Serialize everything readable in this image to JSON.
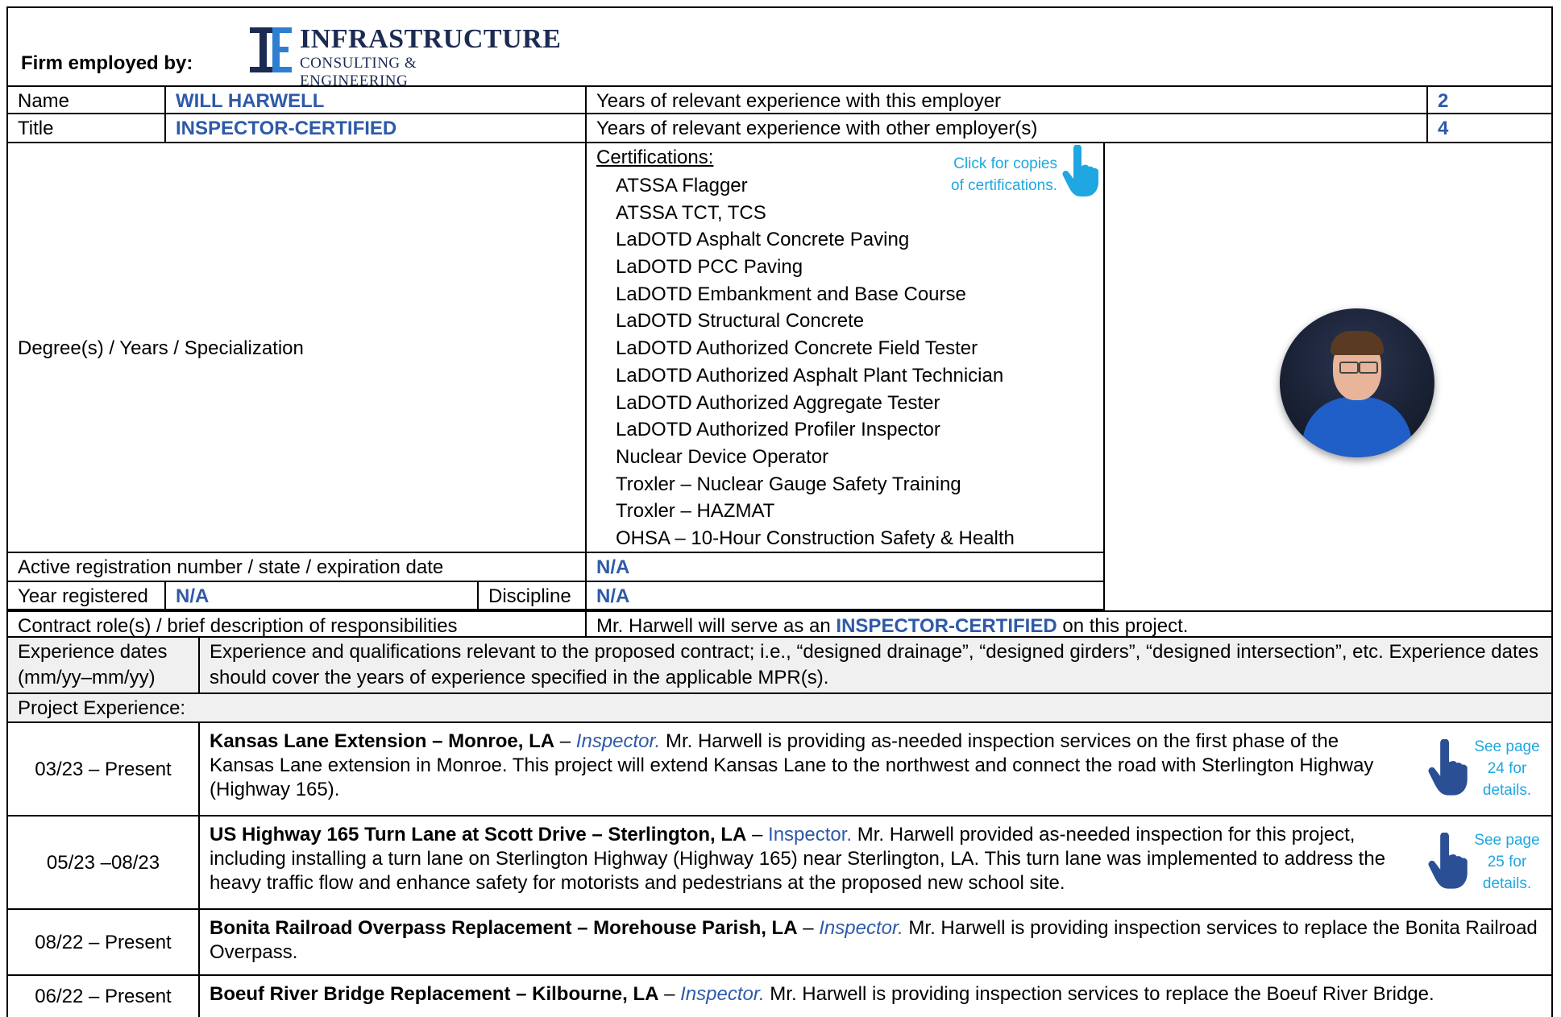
{
  "header": {
    "firm_label": "Firm employed by:",
    "logo_main": "INFRASTRUCTURE",
    "logo_sub": "CONSULTING & ENGINEERING"
  },
  "rows": {
    "name_label": "Name",
    "name_value": "WILL HARWELL",
    "years_this_label": "Years of relevant experience with this employer",
    "years_this_value": "2",
    "title_label": "Title",
    "title_value": "INSPECTOR-CERTIFIED",
    "years_other_label": "Years of relevant experience with other employer(s)",
    "years_other_value": "4",
    "degree_label": "Degree(s) / Years / Specialization",
    "registration_label": "Active registration number / state / expiration date",
    "registration_value": "N/A",
    "year_registered_label": "Year registered",
    "year_registered_value": "N/A",
    "discipline_label": "Discipline",
    "discipline_value": "N/A",
    "contract_role_label": "Contract role(s) / brief description of responsibilities",
    "contract_role_prefix": "Mr. Harwell will serve as an ",
    "contract_role_highlight": "INSPECTOR-CERTIFIED",
    "contract_role_suffix": " on this project.",
    "exp_dates_label": "Experience dates (mm/yy–mm/yy)",
    "exp_desc": "Experience and qualifications relevant to the proposed contract; i.e., “designed drainage”, “designed girders”, “designed intersection”, etc.  Experience dates should cover the years of experience specified in the applicable MPR(s).",
    "project_exp_label": "Project Experience:"
  },
  "certifications": {
    "title": "Certifications:",
    "click_note": "Click for copies of certifications.",
    "items": [
      "ATSSA Flagger",
      "ATSSA TCT, TCS",
      "LaDOTD Asphalt Concrete Paving",
      "LaDOTD PCC Paving",
      "LaDOTD Embankment and Base Course",
      "LaDOTD Structural Concrete",
      "LaDOTD Authorized Concrete Field Tester",
      "LaDOTD Authorized Asphalt Plant Technician",
      "LaDOTD Authorized Aggregate Tester",
      "LaDOTD Authorized Profiler Inspector",
      "Nuclear Device Operator",
      "Troxler – Nuclear Gauge Safety Training",
      "Troxler – HAZMAT",
      "OHSA – 10-Hour Construction Safety & Health"
    ]
  },
  "projects": [
    {
      "dates": "03/23 – Present",
      "title": "Kansas Lane Extension – Monroe, LA",
      "role": "Inspector.",
      "desc": " Mr. Harwell is providing as-needed inspection services on the first phase of the Kansas Lane extension in Monroe. This project will extend Kansas Lane to the northwest and connect the road with Sterlington Highway (Highway 165).",
      "see_page": "See page 24 for details."
    },
    {
      "dates": "05/23 –08/23",
      "title": "US Highway 165 Turn Lane at Scott Drive – Sterlington, LA",
      "role": "Inspector.",
      "desc": " Mr. Harwell provided as-needed inspection for this project, including installing a turn lane on Sterlington Highway (Highway 165) near Sterlington, LA. This turn lane was implemented to address the heavy traffic flow and enhance safety for motorists and pedestrians at the proposed new school site.",
      "see_page": "See page 25 for details."
    },
    {
      "dates": "08/22 – Present",
      "title": "Bonita Railroad Overpass Replacement – Morehouse Parish, LA",
      "role": "Inspector.",
      "desc": " Mr. Harwell is providing inspection services to replace the Bonita Railroad Overpass."
    },
    {
      "dates": "06/22 – Present",
      "title": "Boeuf River Bridge Replacement – Kilbourne, LA",
      "role": "Inspector.",
      "desc": " Mr. Harwell is providing inspection services to replace the Boeuf River Bridge."
    }
  ],
  "sep": " – ",
  "colors": {
    "accent_blue": "#2e5aa8",
    "link_cyan": "#1ea7e1",
    "header_gray": "#f0f0f0",
    "logo_navy": "#1d2b52"
  }
}
